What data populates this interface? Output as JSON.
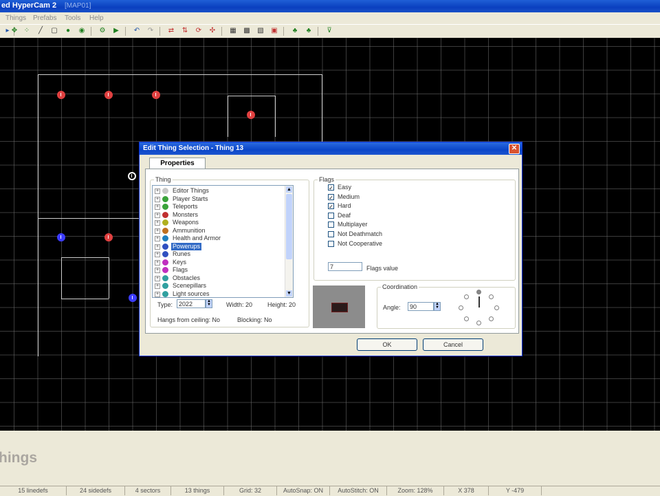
{
  "window": {
    "title": "ed HyperCam 2",
    "title_suffix": "[MAP01]"
  },
  "menu": [
    "Things",
    "Prefabs",
    "Tools",
    "Help"
  ],
  "map": {
    "colors": {
      "red": "#e04040",
      "blue": "#3c3cff",
      "white": "#ffffff",
      "lines": "#cfcfcf"
    }
  },
  "bottom_panel": {
    "mode_label": "hings"
  },
  "status": {
    "linedefs": "15 linedefs",
    "sidedefs": "24 sidedefs",
    "sectors": "4 sectors",
    "things": "13 things",
    "grid": "Grid: 32",
    "autosnap": "AutoSnap: ON",
    "autostitch": "AutoStitch: ON",
    "zoom": "Zoom: 128%",
    "x": "X 378",
    "y": "Y -479"
  },
  "dialog": {
    "title": "Edit Thing Selection - Thing 13",
    "tab": "Properties",
    "thing_group": "Thing",
    "tree": [
      {
        "label": "Editor Things",
        "color": "#c8c8c8"
      },
      {
        "label": "Player Starts",
        "color": "#3aa33a"
      },
      {
        "label": "Teleports",
        "color": "#3aa33a"
      },
      {
        "label": "Monsters",
        "color": "#c03030"
      },
      {
        "label": "Weapons",
        "color": "#b0b020"
      },
      {
        "label": "Ammunition",
        "color": "#c07020"
      },
      {
        "label": "Health and Armor",
        "color": "#2080c0"
      },
      {
        "label": "Powerups",
        "color": "#3050c0",
        "selected": true
      },
      {
        "label": "Runes",
        "color": "#3050c0"
      },
      {
        "label": "Keys",
        "color": "#c030c0"
      },
      {
        "label": "Flags",
        "color": "#c030c0"
      },
      {
        "label": "Obstacles",
        "color": "#30a0a0"
      },
      {
        "label": "Scenepillars",
        "color": "#30a0a0"
      },
      {
        "label": "Light sources",
        "color": "#30a0a0"
      }
    ],
    "type_label": "Type:",
    "type_value": "2022",
    "width_text": "Width: 20",
    "height_text": "Height: 20",
    "hangs_text": "Hangs from ceiling: No",
    "blocking_text": "Blocking: No",
    "flags_group": "Flags",
    "flags": [
      {
        "label": "Easy",
        "checked": true
      },
      {
        "label": "Medium",
        "checked": true
      },
      {
        "label": "Hard",
        "checked": true
      },
      {
        "label": "Deaf",
        "checked": false
      },
      {
        "label": "Multiplayer",
        "checked": false
      },
      {
        "label": "Not Deathmatch",
        "checked": false
      },
      {
        "label": "Not Cooperative",
        "checked": false
      }
    ],
    "flags_value": "7",
    "flags_value_label": "Flags value",
    "coordination_group": "Coordination",
    "angle_label": "Angle:",
    "angle_value": "90",
    "ok": "OK",
    "cancel": "Cancel"
  }
}
